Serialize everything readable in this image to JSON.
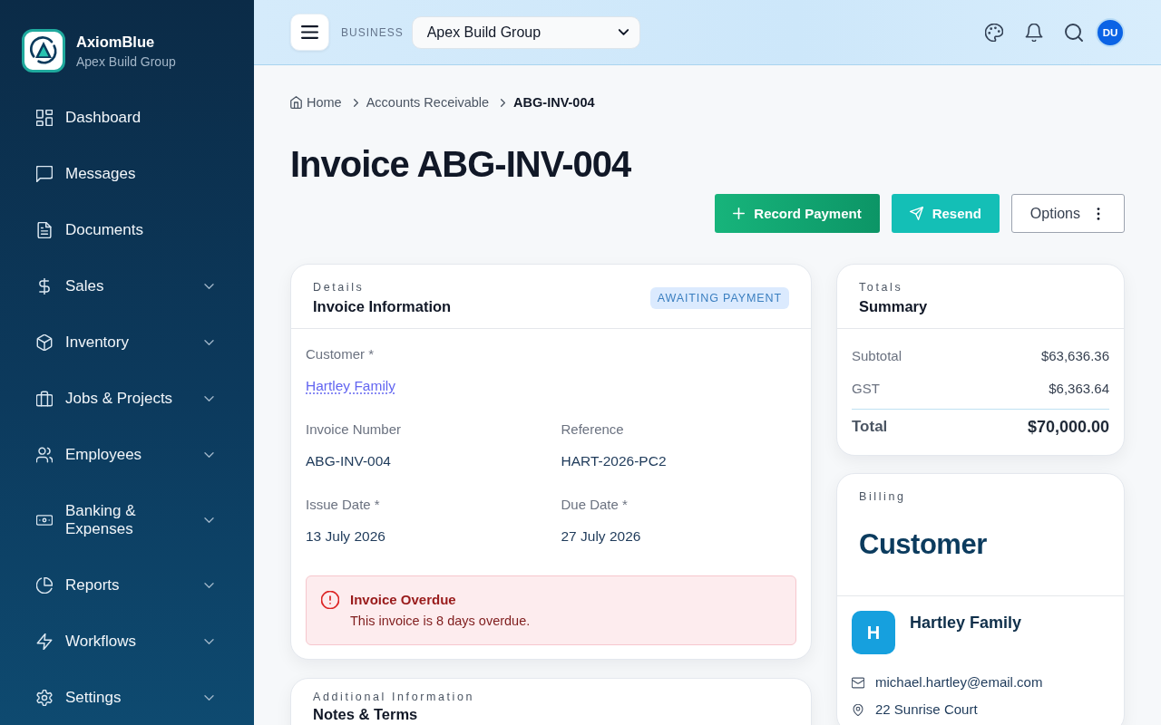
{
  "sidebar": {
    "brand": {
      "name": "AxiomBlue",
      "subtitle": "Apex Build Group"
    },
    "items": [
      {
        "label": "Dashboard",
        "kind": "link"
      },
      {
        "label": "Messages",
        "kind": "link"
      },
      {
        "label": "Documents",
        "kind": "link"
      },
      {
        "label": "Sales",
        "kind": "group",
        "expanded": false
      },
      {
        "label": "Inventory",
        "kind": "group",
        "expanded": false
      },
      {
        "label": "Jobs & Projects",
        "kind": "group",
        "expanded": false
      },
      {
        "label": "Employees",
        "kind": "group",
        "expanded": false
      },
      {
        "label": "Banking & Expenses",
        "kind": "group",
        "expanded": false
      },
      {
        "label": "Reports",
        "kind": "group",
        "expanded": false
      },
      {
        "label": "Workflows",
        "kind": "group",
        "expanded": false
      },
      {
        "label": "Settings",
        "kind": "group",
        "expanded": false
      }
    ]
  },
  "topbar": {
    "business_label": "BUSINESS",
    "business_select": {
      "value": "Apex Build Group"
    },
    "avatar": {
      "initials": "DU"
    }
  },
  "breadcrumb": [
    {
      "label": "Home",
      "current": false
    },
    {
      "label": "Accounts Receivable",
      "current": false
    },
    {
      "label": "ABG-INV-004",
      "current": true
    }
  ],
  "title": "Invoice ABG-INV-004",
  "actions": [
    {
      "label": "Record Payment",
      "kind": "primary"
    },
    {
      "label": "Resend",
      "kind": "secondary"
    },
    {
      "label": "Options",
      "kind": "menu"
    }
  ],
  "details_card": {
    "eyebrow": "Details",
    "title": "Invoice Information",
    "status": "AWAITING PAYMENT",
    "customer": {
      "label": "Customer *",
      "value": "Hartley Family"
    },
    "fields": [
      {
        "label": "Invoice Number",
        "value": "ABG-INV-004"
      },
      {
        "label": "Reference",
        "value": "HART-2026-PC2"
      },
      {
        "label": "Issue Date *",
        "value": "13 July 2026"
      },
      {
        "label": "Due Date *",
        "value": "27 July 2026"
      }
    ],
    "alert": {
      "title": "Invoice Overdue",
      "message": "This invoice is 8 days overdue."
    }
  },
  "notes_card": {
    "eyebrow": "Additional Information",
    "title": "Notes & Terms"
  },
  "summary_card": {
    "eyebrow": "Totals",
    "title": "Summary",
    "rows": [
      {
        "label": "Subtotal",
        "value": "$63,636.36"
      },
      {
        "label": "GST",
        "value": "$6,363.64"
      }
    ],
    "total": {
      "label": "Total",
      "value": "$70,000.00"
    }
  },
  "billing_card": {
    "eyebrow": "Billing",
    "title": "Customer",
    "customer": {
      "initial": "H",
      "name": "Hartley Family",
      "contacts": [
        {
          "kind": "email",
          "text": "michael.hartley@email.com"
        },
        {
          "kind": "address",
          "text": "22 Sunrise Court"
        }
      ]
    }
  }
}
